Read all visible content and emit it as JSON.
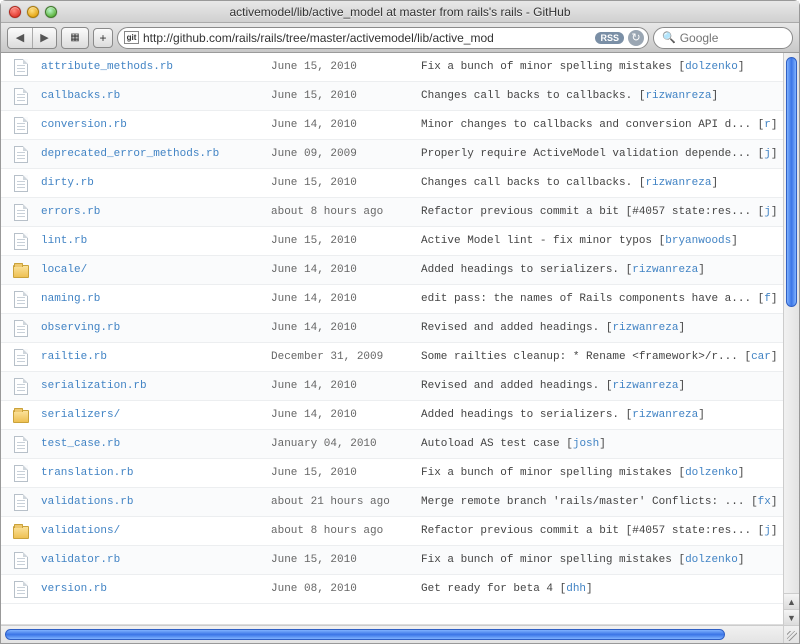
{
  "window": {
    "title": "activemodel/lib/active_model at master from rails's rails - GitHub"
  },
  "toolbar": {
    "url_display": "http://github.com/rails/rails/tree/master/activemodel/lib/active_mod",
    "favicon_text": "git",
    "rss_label": "RSS",
    "search_placeholder": "Google"
  },
  "files": [
    {
      "type": "file",
      "name": "attribute_methods.rb",
      "date": "June 15, 2010",
      "msg_pre": "Fix a bunch of minor spelling mistakes ",
      "author": "dolzenko",
      "msg_post": ""
    },
    {
      "type": "file",
      "name": "callbacks.rb",
      "date": "June 15, 2010",
      "msg_pre": "Changes call backs to callbacks. ",
      "author": "rizwanreza",
      "msg_post": ""
    },
    {
      "type": "file",
      "name": "conversion.rb",
      "date": "June 14, 2010",
      "msg_pre": "Minor changes to callbacks and conversion API d... ",
      "author": "r",
      "msg_post": ""
    },
    {
      "type": "file",
      "name": "deprecated_error_methods.rb",
      "date": "June 09, 2009",
      "msg_pre": "Properly require ActiveModel validation depende... ",
      "author": "j",
      "msg_post": ""
    },
    {
      "type": "file",
      "name": "dirty.rb",
      "date": "June 15, 2010",
      "msg_pre": "Changes call backs to callbacks. ",
      "author": "rizwanreza",
      "msg_post": ""
    },
    {
      "type": "file",
      "name": "errors.rb",
      "date": "about 8 hours ago",
      "msg_pre": "Refactor previous commit a bit [#4057 state:res... ",
      "author": "j",
      "msg_post": ""
    },
    {
      "type": "file",
      "name": "lint.rb",
      "date": "June 15, 2010",
      "msg_pre": "Active Model lint - fix minor typos ",
      "author": "bryanwoods",
      "msg_post": ""
    },
    {
      "type": "folder",
      "name": "locale/",
      "date": "June 14, 2010",
      "msg_pre": "Added headings to serializers. ",
      "author": "rizwanreza",
      "msg_post": ""
    },
    {
      "type": "file",
      "name": "naming.rb",
      "date": "June 14, 2010",
      "msg_pre": "edit pass: the names of Rails components have a... ",
      "author": "f",
      "msg_post": ""
    },
    {
      "type": "file",
      "name": "observing.rb",
      "date": "June 14, 2010",
      "msg_pre": "Revised and added headings. ",
      "author": "rizwanreza",
      "msg_post": ""
    },
    {
      "type": "file",
      "name": "railtie.rb",
      "date": "December 31, 2009",
      "msg_pre": "Some railties cleanup: * Rename <framework>/r... ",
      "author": "car",
      "msg_post": ""
    },
    {
      "type": "file",
      "name": "serialization.rb",
      "date": "June 14, 2010",
      "msg_pre": "Revised and added headings. ",
      "author": "rizwanreza",
      "msg_post": ""
    },
    {
      "type": "folder",
      "name": "serializers/",
      "date": "June 14, 2010",
      "msg_pre": "Added headings to serializers. ",
      "author": "rizwanreza",
      "msg_post": ""
    },
    {
      "type": "file",
      "name": "test_case.rb",
      "date": "January 04, 2010",
      "msg_pre": "Autoload AS test case ",
      "author": "josh",
      "msg_post": ""
    },
    {
      "type": "file",
      "name": "translation.rb",
      "date": "June 15, 2010",
      "msg_pre": "Fix a bunch of minor spelling mistakes ",
      "author": "dolzenko",
      "msg_post": ""
    },
    {
      "type": "file",
      "name": "validations.rb",
      "date": "about 21 hours ago",
      "msg_pre": "Merge remote branch 'rails/master' Conflicts: ... ",
      "author": "fx",
      "msg_post": ""
    },
    {
      "type": "folder",
      "name": "validations/",
      "date": "about 8 hours ago",
      "msg_pre": "Refactor previous commit a bit [#4057 state:res... ",
      "author": "j",
      "msg_post": ""
    },
    {
      "type": "file",
      "name": "validator.rb",
      "date": "June 15, 2010",
      "msg_pre": "Fix a bunch of minor spelling mistakes ",
      "author": "dolzenko",
      "msg_post": ""
    },
    {
      "type": "file",
      "name": "version.rb",
      "date": "June 08, 2010",
      "msg_pre": "Get ready for beta 4 ",
      "author": "dhh",
      "msg_post": ""
    }
  ]
}
